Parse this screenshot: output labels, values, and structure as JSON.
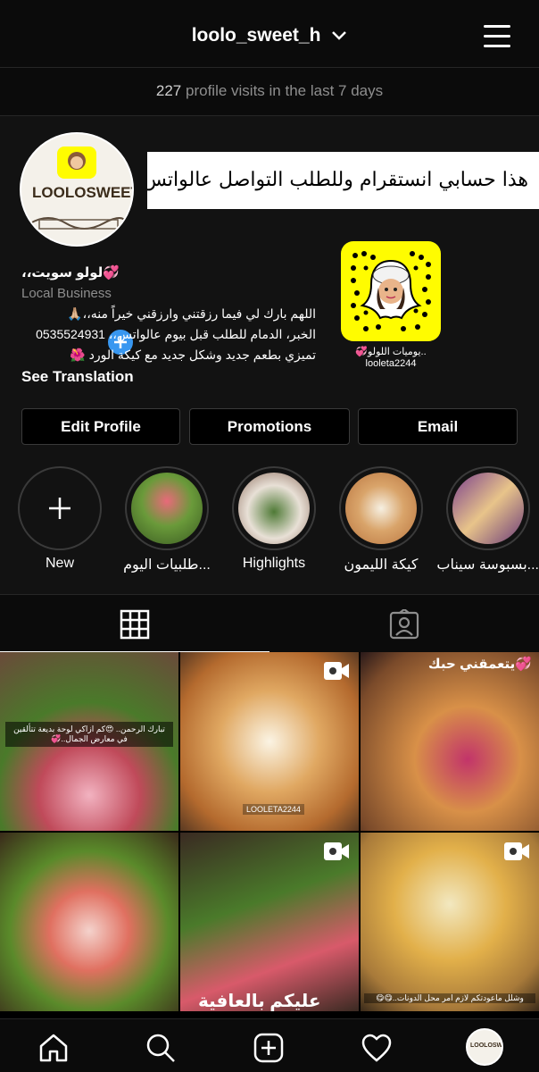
{
  "header": {
    "username": "loolo_sweet_h"
  },
  "visits": {
    "count": "227",
    "text": "profile visits in the last 7 days"
  },
  "profile": {
    "avatar_logo": "LOOLOSWEET",
    "banner_text": "هذا حسابي انستقرام وللطلب التواصل عالواتس..👍🏼",
    "name": "💞لولو سويت،،",
    "category": "Local Business",
    "bio_lines": [
      "اللهم بارك لي فيما رزقتني وارزقني خيراً منه،،🙏🏼",
      "الخبر، الدمام للطلب قبل بيوم عالواتس،، 0535524931",
      "تميزي بطعم جديد وشكل جديد مع كيكة الورد 🌺"
    ],
    "see_translation": "See Translation",
    "snap_caption_line1": "💞يوميات اللولو..",
    "snap_caption_line2": "looleta2244"
  },
  "buttons": {
    "edit": "Edit Profile",
    "promotions": "Promotions",
    "email": "Email"
  },
  "highlights": [
    {
      "label": "New"
    },
    {
      "label": "طلبيات اليوم..."
    },
    {
      "label": "Highlights"
    },
    {
      "label": "كيكة الليمون"
    },
    {
      "label": "بسبوسة سيناب..."
    }
  ],
  "grid": {
    "cell1_caption": "تبارك الرحمن.. 😍كم ازاكي لوحة بديعة تتألقين في معارض الجمال..💞",
    "cell3_caption": "💞يتعمقني حبك",
    "cell2_watermark": "LOOLETA2244",
    "cell5_caption": "عليكم بالعافية",
    "cell6_caption": "وشلل ماعودتكم لازم امر محل الدونات..😋😋"
  },
  "colors": {
    "accent": "#3897f0",
    "background": "#000000",
    "snap_yellow": "#fffc00"
  }
}
